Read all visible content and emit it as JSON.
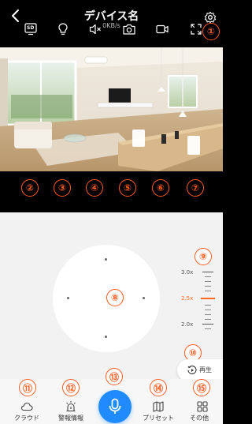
{
  "header": {
    "title": "デバイス名",
    "subtitle": "0KB/s"
  },
  "markers": [
    "①",
    "②",
    "③",
    "④",
    "⑤",
    "⑥",
    "⑦",
    "⑧",
    "⑨",
    "⑩",
    "⑪",
    "⑫",
    "⑬",
    "⑭",
    "⑮"
  ],
  "toolbar": {
    "quality_label": "SD"
  },
  "zoom": {
    "levels": [
      "3.0x",
      "2.5x",
      "2.0x"
    ],
    "current": "2.5x"
  },
  "playback": {
    "label": "再生"
  },
  "nav": {
    "cloud": "クラウド",
    "alarm": "警報情報",
    "preset": "プリセット",
    "more": "その他"
  },
  "colors": {
    "accent": "#ff5a1f",
    "mic": "#1f8bff"
  }
}
